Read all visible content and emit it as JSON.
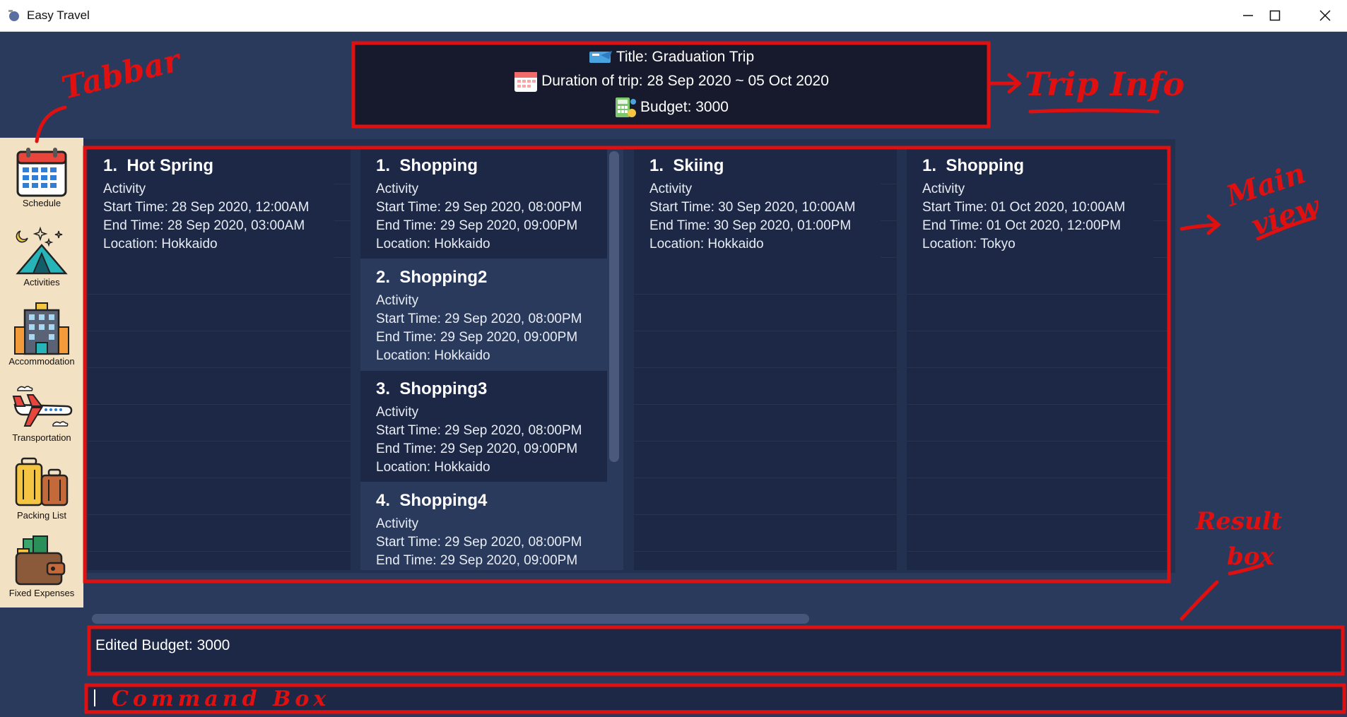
{
  "window": {
    "title": "Easy Travel"
  },
  "trip_info": {
    "title_line": "Title: Graduation Trip",
    "duration_line": "Duration of trip: 28 Sep 2020 ~ 05 Oct 2020",
    "budget_line": "Budget: 3000"
  },
  "tabs": [
    {
      "label": "Schedule",
      "icon": "calendar-icon"
    },
    {
      "label": "Activities",
      "icon": "tent-icon"
    },
    {
      "label": "Accommodation",
      "icon": "hotel-icon"
    },
    {
      "label": "Transportation",
      "icon": "airplane-icon"
    },
    {
      "label": "Packing List",
      "icon": "luggage-icon"
    },
    {
      "label": "Fixed Expenses",
      "icon": "wallet-icon"
    }
  ],
  "days": [
    {
      "items": [
        {
          "index": "1.",
          "name": "Hot Spring",
          "type": "Activity",
          "start": "Start Time: 28 Sep 2020, 12:00AM",
          "end": "End Time: 28 Sep 2020, 03:00AM",
          "location": "Location: Hokkaido"
        }
      ]
    },
    {
      "items": [
        {
          "index": "1.",
          "name": "Shopping",
          "type": "Activity",
          "start": "Start Time: 29 Sep 2020, 08:00PM",
          "end": "End Time: 29 Sep 2020, 09:00PM",
          "location": "Location: Hokkaido"
        },
        {
          "index": "2.",
          "name": "Shopping2",
          "type": "Activity",
          "start": "Start Time: 29 Sep 2020, 08:00PM",
          "end": "End Time: 29 Sep 2020, 09:00PM",
          "location": "Location: Hokkaido"
        },
        {
          "index": "3.",
          "name": "Shopping3",
          "type": "Activity",
          "start": "Start Time: 29 Sep 2020, 08:00PM",
          "end": "End Time: 29 Sep 2020, 09:00PM",
          "location": "Location: Hokkaido"
        },
        {
          "index": "4.",
          "name": "Shopping4",
          "type": "Activity",
          "start": "Start Time: 29 Sep 2020, 08:00PM",
          "end": "End Time: 29 Sep 2020, 09:00PM"
        }
      ]
    },
    {
      "items": [
        {
          "index": "1.",
          "name": "Skiing",
          "type": "Activity",
          "start": "Start Time: 30 Sep 2020, 10:00AM",
          "end": "End Time: 30 Sep 2020, 01:00PM",
          "location": "Location: Hokkaido"
        }
      ]
    },
    {
      "items": [
        {
          "index": "1.",
          "name": "Shopping",
          "type": "Activity",
          "start": "Start Time: 01 Oct 2020, 10:00AM",
          "end": "End Time: 01 Oct 2020, 12:00PM",
          "location": "Location: Tokyo"
        }
      ]
    }
  ],
  "result_box": {
    "text": "Edited Budget: 3000"
  },
  "command_box": {
    "value": ""
  },
  "annotations": {
    "tabbar": "Tabbar",
    "trip_info": "Trip Info",
    "main_view_1": "Main",
    "main_view_2": "view",
    "result_1": "Result",
    "result_2": "box",
    "command": "Command Box"
  },
  "colors": {
    "annotation": "#e01010",
    "background": "#2a3a5c",
    "panel": "#1c2845",
    "sidebar": "#f3e1c4"
  }
}
